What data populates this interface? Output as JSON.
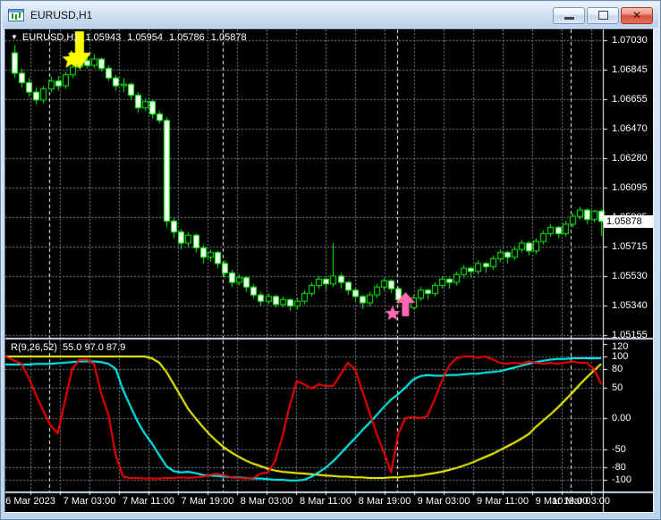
{
  "window": {
    "title": "EURUSD,H1",
    "close_glyph": "✕"
  },
  "header": {
    "dropdown": "▼",
    "symbol": "EURUSD,H1",
    "open": "1.05943",
    "high": "1.05954",
    "low": "1.05786",
    "close": "1.05878"
  },
  "indicator_header": {
    "name": "R(9,26,52)",
    "values": "55.0 97.0 87.9"
  },
  "chart_data": {
    "type": "candlestick",
    "symbol": "EURUSD",
    "timeframe": "H1",
    "title": "EURUSD,H1 1.05943 1.05954 1.05786 1.05878",
    "price_axis": {
      "ticks": [
        "1.07030",
        "1.06845",
        "1.06655",
        "1.06470",
        "1.06280",
        "1.06095",
        "1.05905",
        "1.05715",
        "1.05530",
        "1.05340",
        "1.05155"
      ],
      "current": "1.05878"
    },
    "time_axis": {
      "labels": [
        "6 Mar 2023",
        "7 Mar 03:00",
        "7 Mar 11:00",
        "7 Mar 19:00",
        "8 Mar 03:00",
        "8 Mar 11:00",
        "8 Mar 19:00",
        "9 Mar 03:00",
        "9 Mar 11:00",
        "9 Mar 19:00",
        "10 Mar 03:00"
      ]
    },
    "day_separator_candles": [
      4.8,
      28.8,
      52.8,
      76.8
    ],
    "candles": [
      [
        1.0695,
        1.07,
        1.0679,
        1.0682
      ],
      [
        1.0682,
        1.0685,
        1.0673,
        1.0676
      ],
      [
        1.0676,
        1.0679,
        1.0667,
        1.067
      ],
      [
        1.067,
        1.0673,
        1.0662,
        1.0665
      ],
      [
        1.0665,
        1.0674,
        1.0663,
        1.0672
      ],
      [
        1.0672,
        1.068,
        1.067,
        1.0677
      ],
      [
        1.0677,
        1.068,
        1.0671,
        1.0674
      ],
      [
        1.0674,
        1.0683,
        1.0672,
        1.0681
      ],
      [
        1.0681,
        1.0688,
        1.0679,
        1.0686
      ],
      [
        1.0686,
        1.0693,
        1.0684,
        1.069
      ],
      [
        1.069,
        1.0692,
        1.0685,
        1.0687
      ],
      [
        1.0687,
        1.0694,
        1.0685,
        1.0691
      ],
      [
        1.0691,
        1.0692,
        1.0683,
        1.0685
      ],
      [
        1.0685,
        1.0687,
        1.0677,
        1.0679
      ],
      [
        1.0679,
        1.0681,
        1.0671,
        1.0674
      ],
      [
        1.0674,
        1.0679,
        1.067,
        1.0675
      ],
      [
        1.0675,
        1.0676,
        1.0665,
        1.0668
      ],
      [
        1.0668,
        1.067,
        1.0657,
        1.066
      ],
      [
        1.066,
        1.0666,
        1.0658,
        1.0664
      ],
      [
        1.0664,
        1.0665,
        1.0653,
        1.0656
      ],
      [
        1.0656,
        1.0658,
        1.065,
        1.0652
      ],
      [
        1.0652,
        1.0654,
        1.0584,
        1.0588
      ],
      [
        1.0588,
        1.059,
        1.0577,
        1.0581
      ],
      [
        1.0581,
        1.0583,
        1.057,
        1.0574
      ],
      [
        1.0574,
        1.0581,
        1.0571,
        1.0579
      ],
      [
        1.0579,
        1.058,
        1.0568,
        1.0571
      ],
      [
        1.0571,
        1.0573,
        1.0561,
        1.0565
      ],
      [
        1.0565,
        1.057,
        1.0562,
        1.0568
      ],
      [
        1.0568,
        1.0569,
        1.0558,
        1.0561
      ],
      [
        1.0561,
        1.0563,
        1.0552,
        1.0555
      ],
      [
        1.0555,
        1.0557,
        1.0546,
        1.0549
      ],
      [
        1.0549,
        1.0554,
        1.0547,
        1.0552
      ],
      [
        1.0552,
        1.0553,
        1.0543,
        1.0546
      ],
      [
        1.0546,
        1.0548,
        1.0539,
        1.0541
      ],
      [
        1.0541,
        1.0543,
        1.0534,
        1.0537
      ],
      [
        1.0537,
        1.0542,
        1.0535,
        1.054
      ],
      [
        1.054,
        1.0541,
        1.0533,
        1.0535
      ],
      [
        1.0535,
        1.054,
        1.0533,
        1.0538
      ],
      [
        1.0538,
        1.0539,
        1.0531,
        1.0534
      ],
      [
        1.0534,
        1.0539,
        1.0532,
        1.0537
      ],
      [
        1.0537,
        1.0544,
        1.0535,
        1.0542
      ],
      [
        1.0542,
        1.0549,
        1.054,
        1.0547
      ],
      [
        1.0547,
        1.0553,
        1.0545,
        1.0551
      ],
      [
        1.0551,
        1.0552,
        1.0544,
        1.0548
      ],
      [
        1.0548,
        1.0574,
        1.0546,
        1.0553
      ],
      [
        1.0553,
        1.0555,
        1.0545,
        1.0549
      ],
      [
        1.0549,
        1.055,
        1.0541,
        1.0544
      ],
      [
        1.0544,
        1.0546,
        1.0537,
        1.054
      ],
      [
        1.054,
        1.0541,
        1.0532,
        1.0536
      ],
      [
        1.0536,
        1.0543,
        1.0534,
        1.0541
      ],
      [
        1.0541,
        1.0548,
        1.0539,
        1.0546
      ],
      [
        1.0546,
        1.0552,
        1.0544,
        1.055
      ],
      [
        1.055,
        1.0551,
        1.0542,
        1.0545
      ],
      [
        1.0545,
        1.0546,
        1.0535,
        1.0538
      ],
      [
        1.0538,
        1.0539,
        1.053,
        1.0533
      ],
      [
        1.0533,
        1.0541,
        1.0532,
        1.0539
      ],
      [
        1.0539,
        1.0546,
        1.0537,
        1.0544
      ],
      [
        1.0544,
        1.0545,
        1.0538,
        1.0542
      ],
      [
        1.0542,
        1.0549,
        1.054,
        1.0547
      ],
      [
        1.0547,
        1.0553,
        1.0545,
        1.0551
      ],
      [
        1.0551,
        1.0552,
        1.0545,
        1.0549
      ],
      [
        1.0549,
        1.0556,
        1.0547,
        1.0554
      ],
      [
        1.0554,
        1.056,
        1.0552,
        1.0558
      ],
      [
        1.0558,
        1.0559,
        1.0552,
        1.0556
      ],
      [
        1.0556,
        1.0563,
        1.0554,
        1.0561
      ],
      [
        1.0561,
        1.0562,
        1.0555,
        1.0559
      ],
      [
        1.0559,
        1.0566,
        1.0557,
        1.0564
      ],
      [
        1.0564,
        1.057,
        1.0562,
        1.0568
      ],
      [
        1.0568,
        1.0569,
        1.0561,
        1.0565
      ],
      [
        1.0565,
        1.0572,
        1.0563,
        1.057
      ],
      [
        1.057,
        1.0576,
        1.0568,
        1.0574
      ],
      [
        1.0574,
        1.0575,
        1.0566,
        1.0569
      ],
      [
        1.0569,
        1.0577,
        1.0567,
        1.0575
      ],
      [
        1.0575,
        1.0582,
        1.0573,
        1.058
      ],
      [
        1.058,
        1.0586,
        1.0578,
        1.0584
      ],
      [
        1.0584,
        1.0585,
        1.0577,
        1.058
      ],
      [
        1.058,
        1.0588,
        1.0578,
        1.0586
      ],
      [
        1.0586,
        1.0593,
        1.0584,
        1.0591
      ],
      [
        1.0591,
        1.0597,
        1.0589,
        1.0595
      ],
      [
        1.0595,
        1.0596,
        1.0586,
        1.0589
      ],
      [
        1.0589,
        1.0595,
        1.0587,
        1.05943
      ],
      [
        1.05943,
        1.05954,
        1.05786,
        1.05878
      ]
    ],
    "oscillator": {
      "label": "R(9,26,52)",
      "current_values": [
        55.0,
        97.0,
        87.9
      ],
      "axis_ticks": [
        "120",
        "100",
        "80",
        "50",
        "0.00",
        "-50",
        "-80",
        "-100"
      ],
      "levels": [
        100,
        80,
        50,
        0,
        -50,
        -80,
        -100
      ],
      "series": [
        {
          "name": "red",
          "color": "#FF0000",
          "values": [
            100,
            88,
            65,
            37,
            12,
            -12,
            -25,
            28,
            80,
            95,
            95,
            88,
            40,
            5,
            -60,
            -95,
            -97,
            -97,
            -98,
            -98,
            -98,
            -97,
            -97,
            -96,
            -97,
            -96,
            -95,
            -92,
            -90,
            -93,
            -96,
            -97,
            -98,
            -97,
            -90,
            -88,
            -70,
            -30,
            20,
            60,
            55,
            48,
            55,
            52,
            52,
            70,
            90,
            80,
            45,
            10,
            -25,
            -55,
            -88,
            -25,
            0,
            2,
            0,
            3,
            30,
            60,
            85,
            97,
            100,
            100,
            98,
            100,
            95,
            90,
            88,
            90,
            88,
            92,
            90,
            88,
            90,
            88,
            90,
            92,
            90,
            90,
            80,
            55
          ]
        },
        {
          "name": "cyan",
          "color": "#00FFFF",
          "values": [
            87,
            87,
            87,
            88,
            88,
            88,
            89,
            90,
            91,
            92,
            92,
            92,
            91,
            88,
            80,
            46,
            20,
            -5,
            -25,
            -41,
            -60,
            -78,
            -86,
            -88,
            -87,
            -89,
            -92,
            -93,
            -94,
            -95,
            -96,
            -96,
            -97,
            -98,
            -98,
            -99,
            -100,
            -100,
            -101,
            -101,
            -100,
            -95,
            -88,
            -80,
            -70,
            -58,
            -45,
            -33,
            -20,
            -8,
            5,
            18,
            30,
            39,
            50,
            62,
            68,
            70,
            69,
            69,
            70,
            70,
            71,
            72,
            72,
            74,
            75,
            76,
            79,
            82,
            85,
            88,
            91,
            93,
            95,
            96,
            96,
            97,
            97,
            97,
            97,
            97
          ]
        },
        {
          "name": "yellow",
          "color": "#FFFF00",
          "values": [
            100,
            100,
            100,
            100,
            100,
            100,
            100,
            100,
            100,
            100,
            100,
            100,
            100,
            100,
            100,
            100,
            100,
            100,
            100,
            97,
            90,
            75,
            55,
            35,
            15,
            0,
            -14,
            -27,
            -38,
            -48,
            -56,
            -63,
            -69,
            -74,
            -78,
            -82,
            -85,
            -87,
            -88,
            -89,
            -90,
            -91,
            -92,
            -93,
            -94,
            -95,
            -95,
            -96,
            -96,
            -97,
            -97,
            -97,
            -96,
            -96,
            -95,
            -94,
            -93,
            -91,
            -89,
            -87,
            -84,
            -81,
            -77,
            -73,
            -68,
            -63,
            -58,
            -52,
            -46,
            -40,
            -33,
            -26,
            -14,
            -4,
            6,
            17,
            29,
            41,
            54,
            66,
            77,
            88
          ]
        }
      ]
    },
    "signals": [
      {
        "name": "sell-signal",
        "shape": "arrow-down",
        "color": "#FFFF00",
        "candle_index": 9
      },
      {
        "name": "buy-signal",
        "shape": "arrow-up",
        "color": "#FF69B4",
        "candle_index": 54
      }
    ],
    "colors": {
      "background": "#000000",
      "grid": "#778899",
      "separator": "#FFFFFF",
      "candle_outline": "#00FF00",
      "bull_fill": "#000000",
      "bear_fill": "#FFFFFF",
      "text": "#FFFFFF",
      "axis_line": "#FFFFFF"
    }
  }
}
